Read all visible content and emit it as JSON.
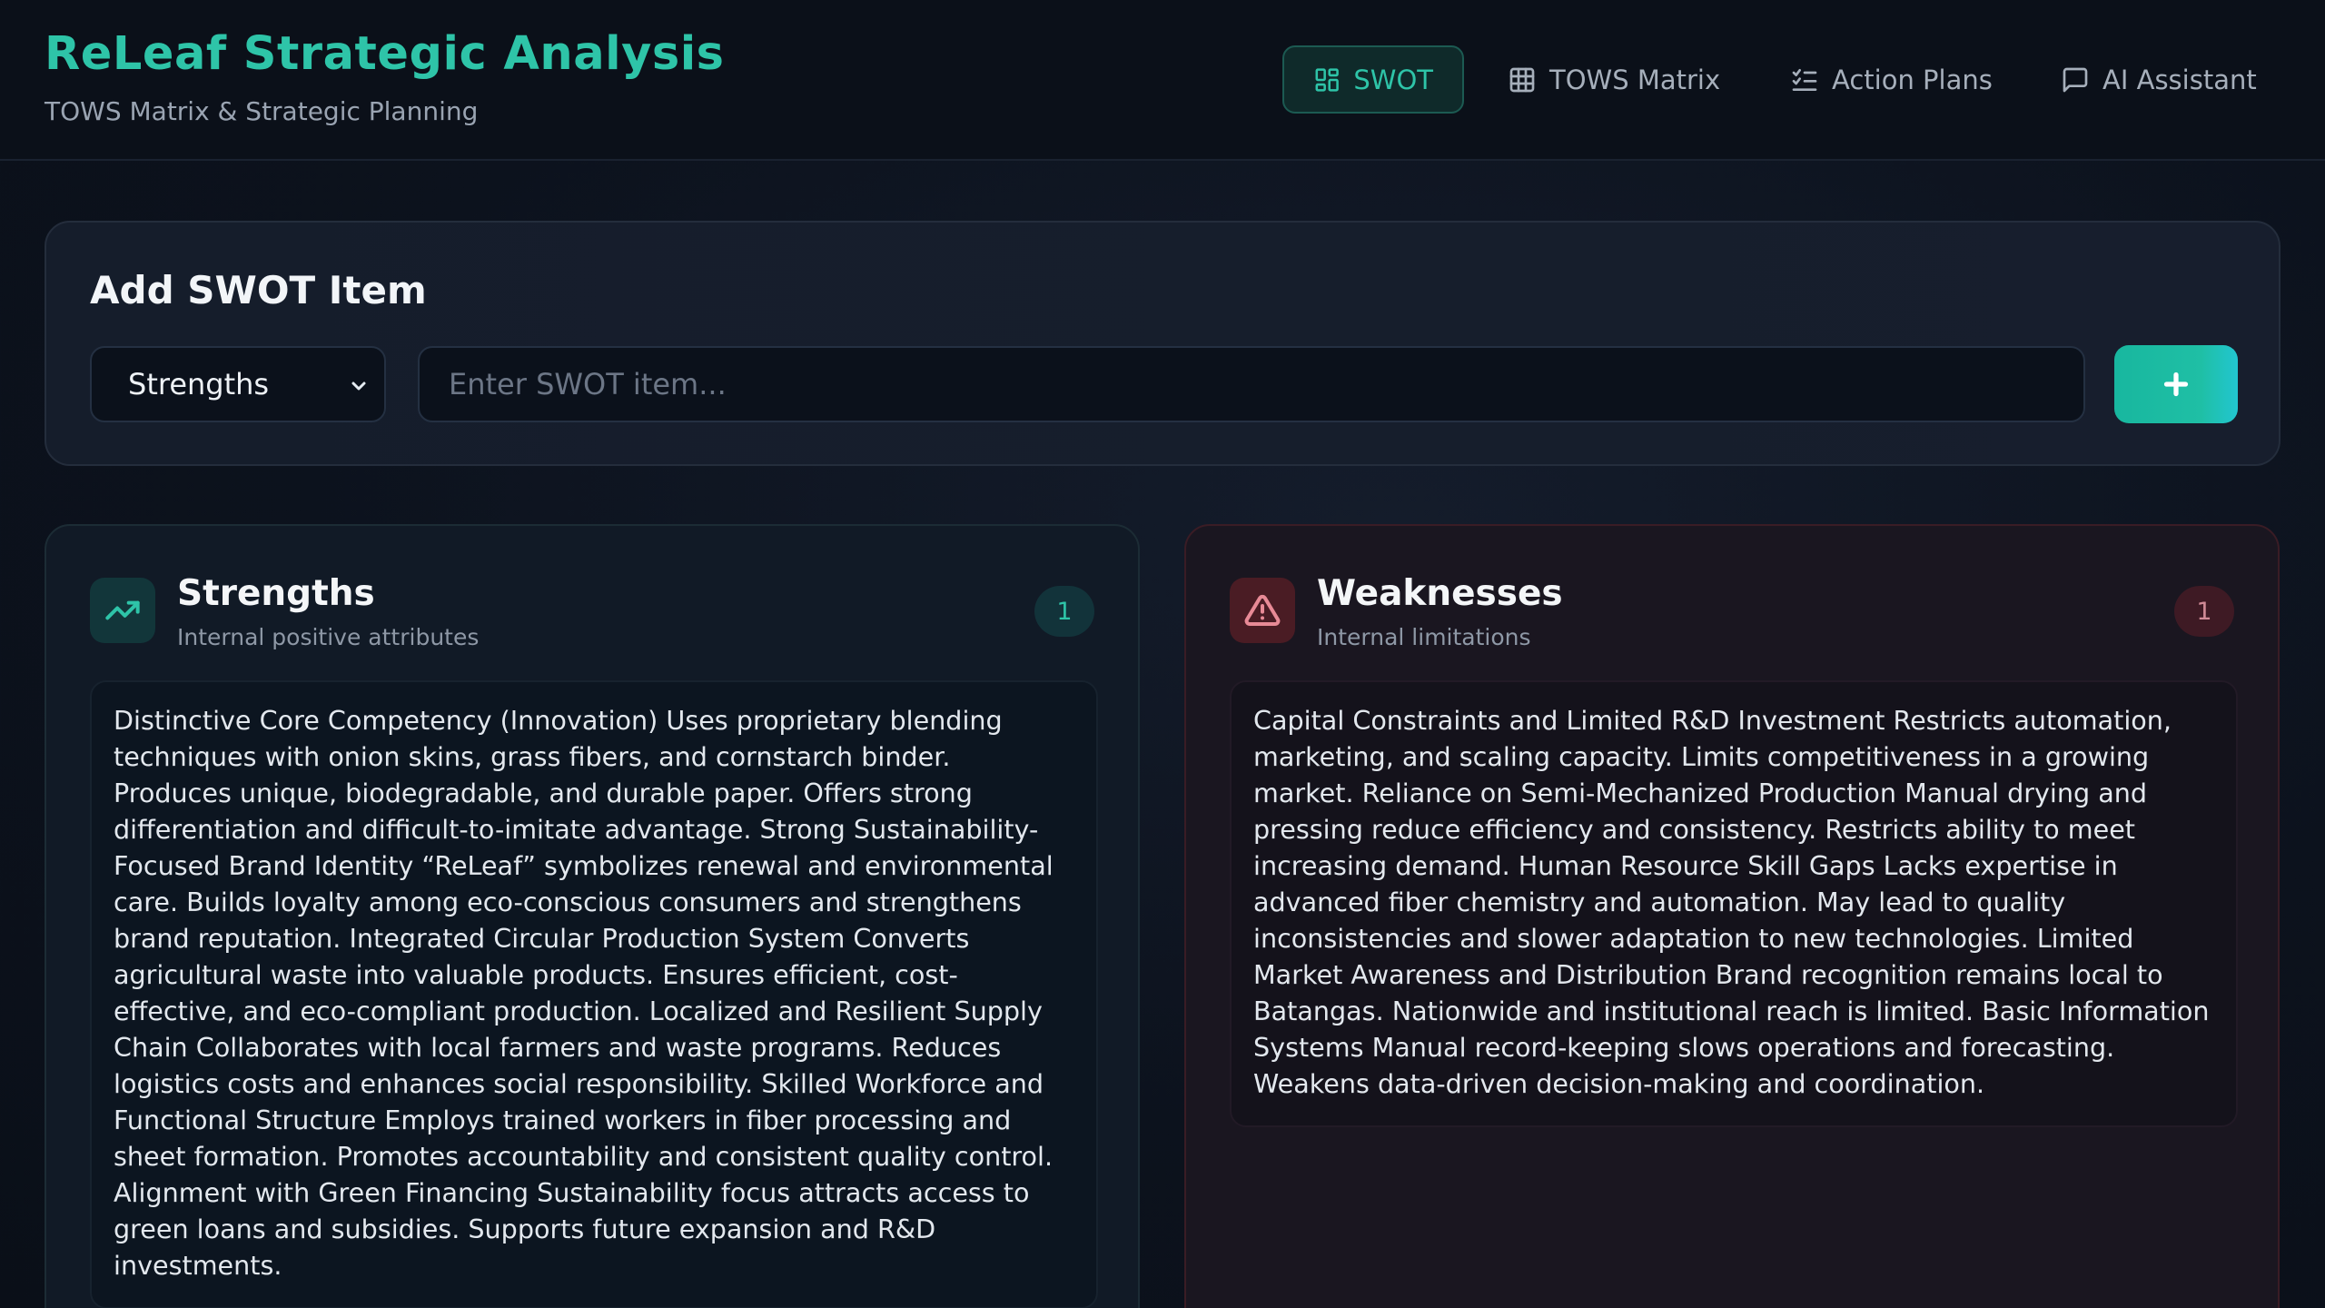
{
  "header": {
    "title": "ReLeaf Strategic Analysis",
    "subtitle": "TOWS Matrix & Strategic Planning"
  },
  "nav": {
    "items": [
      {
        "label": "SWOT",
        "icon": "grid-icon",
        "active": true
      },
      {
        "label": "TOWS Matrix",
        "icon": "table-icon",
        "active": false
      },
      {
        "label": "Action Plans",
        "icon": "list-checks-icon",
        "active": false
      },
      {
        "label": "AI Assistant",
        "icon": "chat-icon",
        "active": false
      }
    ]
  },
  "add_panel": {
    "title": "Add SWOT Item",
    "category_selected": "Strengths",
    "input_placeholder": "Enter SWOT item...",
    "add_button_label": "+"
  },
  "cards": {
    "strengths": {
      "title": "Strengths",
      "subtitle": "Internal positive attributes",
      "count": "1",
      "icon": "trending-up-icon",
      "items": [
        "Distinctive Core Competency (Innovation) Uses proprietary blending techniques with onion skins, grass fibers, and cornstarch binder. Produces unique, biodegradable, and durable paper. Offers strong differentiation and difficult-to-imitate advantage. Strong Sustainability-Focused Brand Identity “ReLeaf” symbolizes renewal and environmental care. Builds loyalty among eco-conscious consumers and strengthens brand reputation. Integrated Circular Production System Converts agricultural waste into valuable products. Ensures efficient, cost-effective, and eco-compliant production. Localized and Resilient Supply Chain Collaborates with local farmers and waste programs. Reduces logistics costs and enhances social responsibility. Skilled Workforce and Functional Structure Employs trained workers in fiber processing and sheet formation. Promotes accountability and consistent quality control. Alignment with Green Financing Sustainability focus attracts access to green loans and subsidies. Supports future expansion and R&D investments."
      ]
    },
    "weaknesses": {
      "title": "Weaknesses",
      "subtitle": "Internal limitations",
      "count": "1",
      "icon": "alert-triangle-icon",
      "items": [
        "Capital Constraints and Limited R&D Investment Restricts automation, marketing, and scaling capacity. Limits competitiveness in a growing market. Reliance on Semi-Mechanized Production Manual drying and pressing reduce efficiency and consistency. Restricts ability to meet increasing demand. Human Resource Skill Gaps Lacks expertise in advanced fiber chemistry and automation. May lead to quality inconsistencies and slower adaptation to new technologies. Limited Market Awareness and Distribution Brand recognition remains local to Batangas. Nationwide and institutional reach is limited. Basic Information Systems Manual record-keeping slows operations and forecasting. Weakens data-driven decision-making and coordination."
      ]
    }
  },
  "colors": {
    "accent": "#2ec4a8",
    "danger": "#e88a96",
    "background": "#0c121d"
  }
}
